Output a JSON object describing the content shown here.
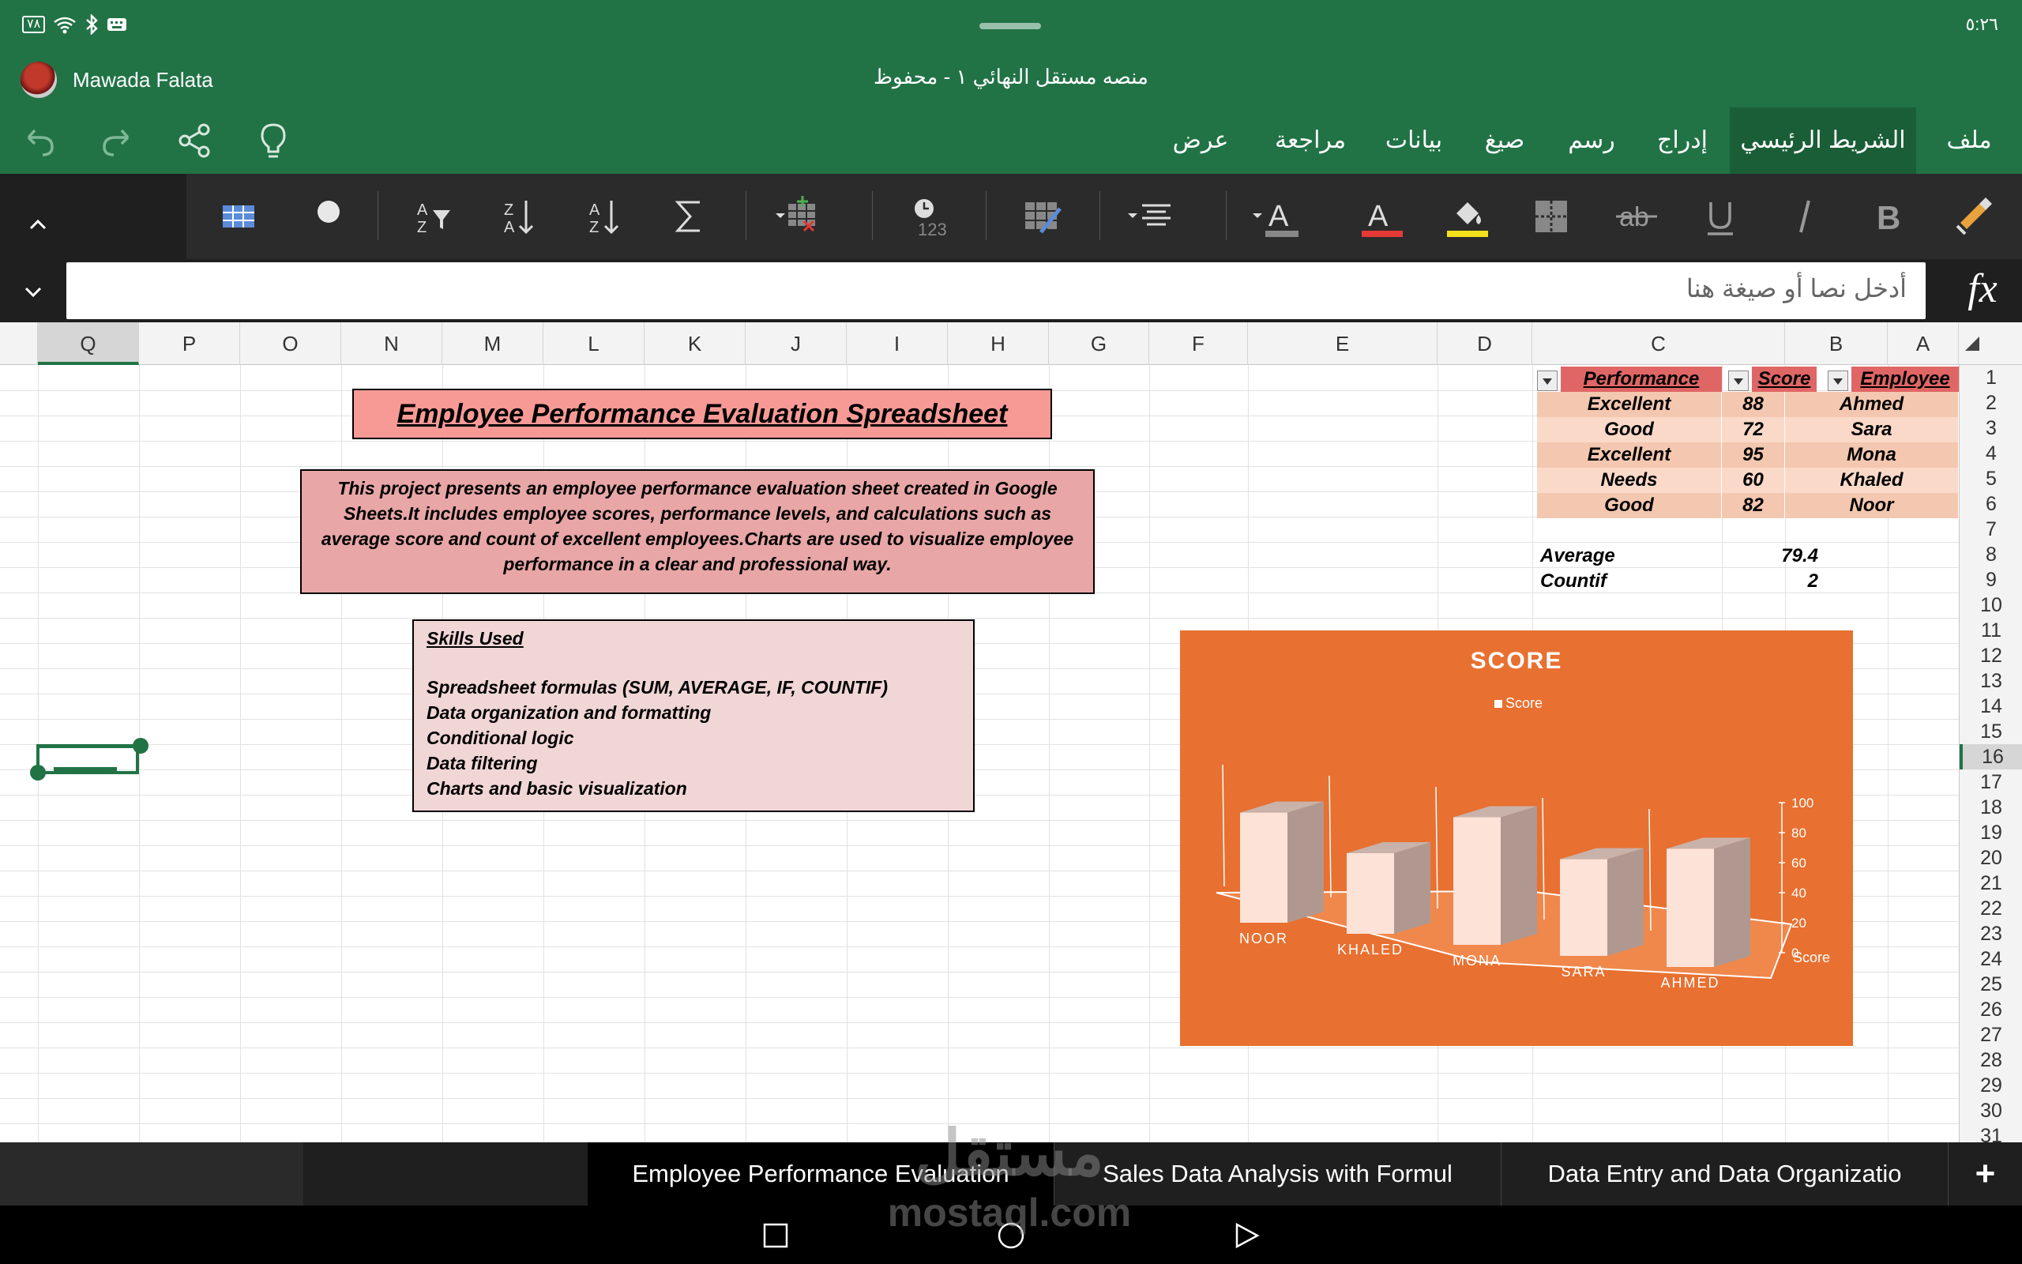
{
  "status_bar": {
    "time": "٥:٢٦",
    "battery": "٧٨"
  },
  "window": {
    "user_name": "Mawada Falata",
    "doc_title": "منصه مستقل النهائي ١ - محفوظ"
  },
  "menu_tabs": [
    {
      "label": "ملف"
    },
    {
      "label": "الشريط الرئيسي",
      "active": true
    },
    {
      "label": "إدراج"
    },
    {
      "label": "رسم"
    },
    {
      "label": "صيغ"
    },
    {
      "label": "بيانات"
    },
    {
      "label": "مراجعة"
    },
    {
      "label": "عرض"
    }
  ],
  "ribbon_icons": [
    "format-painter-icon",
    "bold-icon",
    "italic-icon",
    "underline-icon",
    "strikethrough-icon",
    "borders-icon",
    "fill-color-icon",
    "font-color-icon",
    "font-color-dropdown-icon",
    "align-icon",
    "wrap-text-icon",
    "number-format-icon",
    "cell-styles-icon",
    "autosum-icon",
    "sort-ascending-icon",
    "sort-descending-icon",
    "sort-filter-icon",
    "record-icon",
    "table-icon"
  ],
  "colors": {
    "brand": "#217346",
    "header_cell": "#e06666",
    "row_dark": "#f4c7b0",
    "row_light": "#fbd9c8",
    "chart_bg": "#e87030",
    "bar_front": "#fde2d8",
    "bar_side": "#b09890"
  },
  "formula_bar": {
    "placeholder": "أدخل نصا أو صيغة هنا",
    "fx_label": "fx"
  },
  "columns": [
    "A",
    "B",
    "C",
    "D",
    "E",
    "F",
    "G",
    "H",
    "I",
    "J",
    "K",
    "L",
    "M",
    "N",
    "O",
    "P",
    "Q"
  ],
  "rows": [
    "1",
    "2",
    "3",
    "4",
    "5",
    "6",
    "7",
    "8",
    "9",
    "10",
    "11",
    "12",
    "13",
    "14",
    "15",
    "16",
    "17",
    "18",
    "19",
    "20",
    "21",
    "22",
    "23",
    "24",
    "25",
    "26",
    "27",
    "28",
    "29",
    "30",
    "31"
  ],
  "table": {
    "headers": {
      "employee": "Employee",
      "score": "Score",
      "performance": "Performance"
    },
    "rows": [
      {
        "employee": "Ahmed",
        "score": "88",
        "performance": "Excellent"
      },
      {
        "employee": "Sara",
        "score": "72",
        "performance": "Good"
      },
      {
        "employee": "Mona",
        "score": "95",
        "performance": "Excellent"
      },
      {
        "employee": "Khaled",
        "score": "60",
        "performance": "Needs"
      },
      {
        "employee": "Noor",
        "score": "82",
        "performance": "Good"
      }
    ]
  },
  "stats": {
    "average_label": "Average",
    "average_value": "79.4",
    "countif_label": "Countif",
    "countif_value": "2"
  },
  "title_box": {
    "text": "Employee Performance Evaluation Spreadsheet"
  },
  "description_box": {
    "text": "This project presents an employee performance evaluation sheet created in Google Sheets.It includes employee scores, performance levels, and calculations such as average score and count of excellent employees.Charts are used to visualize employee performance in a clear and professional way."
  },
  "skills_box": {
    "title": "Skills Used",
    "items": [
      "Spreadsheet formulas (SUM, AVERAGE, IF, COUNTIF)",
      "Data organization and formatting",
      "Conditional logic",
      "Data filtering",
      "Charts and basic visualization"
    ]
  },
  "chart_data": {
    "type": "bar",
    "title": "SCORE",
    "categories": [
      "NOOR",
      "KHALED",
      "MONA",
      "SARA",
      "AHMED"
    ],
    "series": [
      {
        "name": "Score",
        "values": [
          82,
          60,
          95,
          72,
          88
        ]
      }
    ],
    "ylim": [
      0,
      100
    ],
    "yticks": [
      "0",
      "20",
      "40",
      "60",
      "80",
      "100"
    ],
    "axis_label": "Score",
    "legend": "top",
    "grid": false
  },
  "sheet_tabs": [
    {
      "label": "Employee Performance Evaluation",
      "active": true
    },
    {
      "label": "Sales Data Analysis with Formul"
    },
    {
      "label": "Data Entry and Data Organizatio"
    }
  ],
  "add_sheet_label": "+",
  "watermark": {
    "line1": "مستقل",
    "line2": "mostaql.com"
  }
}
